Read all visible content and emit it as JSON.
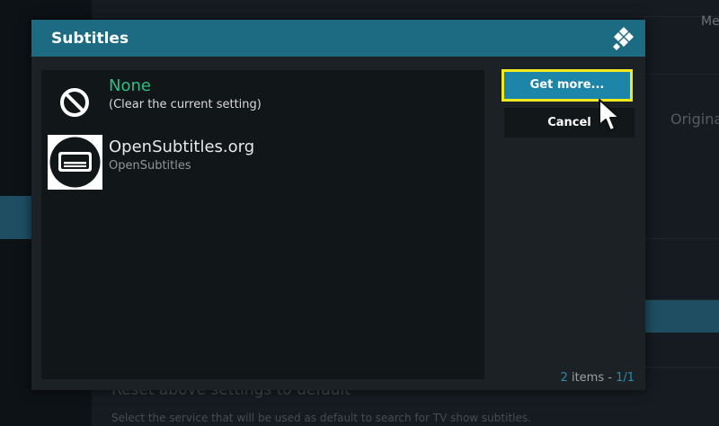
{
  "background": {
    "top_right_text": "Me",
    "right_text": "Origina",
    "reset_text": "Reset above settings to default",
    "description_text": "Select the service that will be used as default to search for TV show subtitles."
  },
  "dialog": {
    "title": "Subtitles",
    "header_color": "#1d6a83",
    "items": [
      {
        "label": "None",
        "sublabel": "(Clear the current setting)",
        "icon": "block-icon",
        "label_color": "#29c086"
      },
      {
        "label": "OpenSubtitles.org",
        "sublabel": "OpenSubtitles",
        "icon": "opensubtitles-icon"
      }
    ],
    "buttons": {
      "get_more": "Get more...",
      "cancel": "Cancel"
    },
    "focus_color": "#f2e81d",
    "footer": {
      "count": "2",
      "items_label": " items - ",
      "page": "1/1"
    }
  }
}
